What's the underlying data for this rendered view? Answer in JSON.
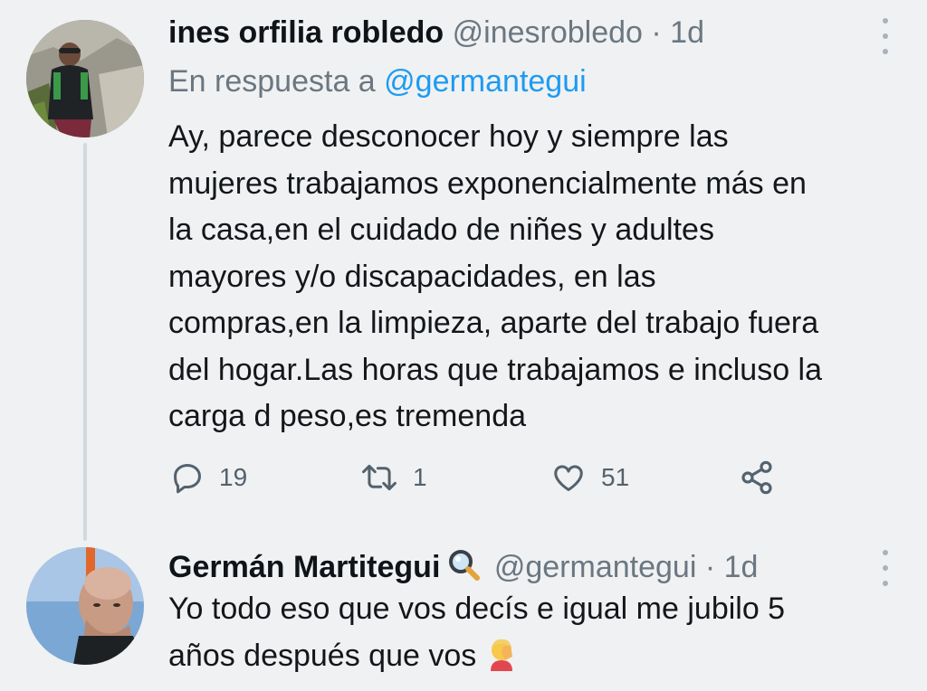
{
  "tweets": [
    {
      "name": "ines orfilia robledo",
      "handle": "@inesrobledo",
      "separator": "·",
      "time": "1d",
      "reply_prefix": "En respuesta a",
      "reply_handle": "@germantegui",
      "text_lines": [
        "Ay, parece desconocer hoy y siempre las",
        "mujeres trabajamos exponencialmente más en",
        "la casa,en el cuidado de niñes y adultes",
        "mayores y/o discapacidades, en las",
        "compras,en la limpieza, aparte del trabajo fuera",
        "del hogar.Las horas que trabajamos e incluso la",
        "carga d peso,es tremenda"
      ],
      "replies": "19",
      "retweets": "1",
      "likes": "51"
    },
    {
      "name": "Germán Martitegui",
      "handle": "@germantegui",
      "separator": "·",
      "time": "1d",
      "text_lines": [
        "Yo todo eso que vos decís e igual me jubilo 5",
        "años después que vos"
      ]
    }
  ],
  "icons": {
    "reply": "reply-icon",
    "retweet": "retweet-icon",
    "like": "heart-icon",
    "share": "share-icon",
    "more": "more-icon",
    "name_emoji": "magnifying-glass-emoji",
    "text_emoji": "facepalm-emoji"
  },
  "colors": {
    "background": "#f0f1f3",
    "text": "#14171a",
    "secondary": "#6b7780",
    "link": "#1d9bf0",
    "thread_line": "#cfd9de"
  }
}
